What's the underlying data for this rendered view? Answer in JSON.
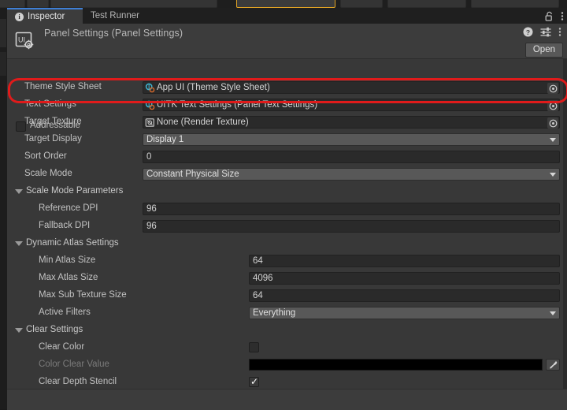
{
  "window": {
    "tabs": [
      {
        "label": "Inspector",
        "icon": "info-icon",
        "active": true
      },
      {
        "label": "Test Runner",
        "icon": "",
        "active": false
      }
    ],
    "tabbar_icons": [
      "lock-icon",
      "kebab-menu-icon"
    ]
  },
  "header": {
    "title": "Panel Settings (Panel Settings)",
    "icon": "panel-settings-asset-icon",
    "icons": [
      "help-icon",
      "preset-icon",
      "kebab-menu-icon"
    ],
    "open_label": "Open"
  },
  "addressable": {
    "label": "Addressable",
    "checked": false
  },
  "fields": [
    {
      "label": "Theme Style Sheet",
      "type": "object",
      "value": "App UI (Theme Style Sheet)",
      "asset_icon": "style-sheet-icon",
      "picker": "object-picker-icon",
      "highlighted": true
    },
    {
      "label": "Text Settings",
      "type": "object",
      "value": "UITK Text Settings (Panel Text Settings)",
      "asset_icon": "text-settings-icon",
      "picker": "object-picker-icon",
      "highlighted": false
    },
    {
      "label": "Target Texture",
      "type": "object",
      "value": "None (Render Texture)",
      "asset_icon": "render-texture-icon",
      "picker": "object-picker-icon",
      "highlighted": false
    },
    {
      "label": "Target Display",
      "type": "popup",
      "value": "Display 1"
    },
    {
      "label": "Sort Order",
      "type": "number",
      "value": "0"
    },
    {
      "label": "Scale Mode",
      "type": "popup",
      "value": "Constant Physical Size"
    }
  ],
  "sections": [
    {
      "label": "Scale Mode Parameters",
      "expanded": true,
      "rows": [
        {
          "label": "Reference DPI",
          "type": "number",
          "value": "96"
        },
        {
          "label": "Fallback DPI",
          "type": "number",
          "value": "96"
        }
      ]
    },
    {
      "label": "Dynamic Atlas Settings",
      "expanded": true,
      "rows": [
        {
          "label": "Min Atlas Size",
          "type": "number",
          "value": "64"
        },
        {
          "label": "Max Atlas Size",
          "type": "number",
          "value": "4096"
        },
        {
          "label": "Max Sub Texture Size",
          "type": "number",
          "value": "64"
        },
        {
          "label": "Active Filters",
          "type": "popup",
          "value": "Everything"
        }
      ]
    },
    {
      "label": "Clear Settings",
      "expanded": true,
      "rows": [
        {
          "label": "Clear Color",
          "type": "checkbox",
          "value": "",
          "checked": false,
          "disabled": false
        },
        {
          "label": "Color Clear Value",
          "type": "color",
          "value": "#000000",
          "disabled": true,
          "eyedropper": "eyedropper-icon"
        },
        {
          "label": "Clear Depth Stencil",
          "type": "checkbox",
          "value": "",
          "checked": true,
          "disabled": false
        }
      ]
    }
  ],
  "colors": {
    "panel_bg": "#383838",
    "header_bg": "#3c3c3c",
    "field_bg": "#2a2a2a",
    "popup_bg": "#585858",
    "accent_tab": "#3e7fd5",
    "highlight_ring": "#e01b1b",
    "sliver_highlight": "#e0a324",
    "color_value": "#000000"
  }
}
